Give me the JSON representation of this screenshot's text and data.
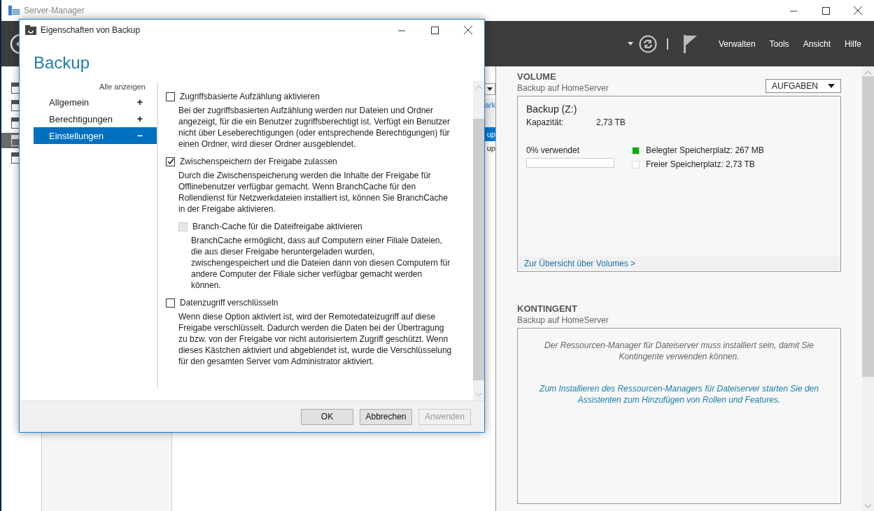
{
  "window": {
    "title": "Server-Manager"
  },
  "menu": [
    "Verwalten",
    "Tools",
    "Ansicht",
    "Hilfe"
  ],
  "nav_items": [
    {
      "selected": false
    },
    {
      "selected": false
    },
    {
      "selected": false
    },
    {
      "selected": true
    },
    {
      "selected": false
    }
  ],
  "center_pane": [
    {
      "text": "ark",
      "kind": "link",
      "selected": false
    },
    {
      "text": "up",
      "kind": "row",
      "selected": true
    },
    {
      "text": "up",
      "kind": "row",
      "selected": false
    }
  ],
  "volume": {
    "heading": "VOLUME",
    "subtitle": "Backup auf HomeServer",
    "tasks_button": "AUFGABEN",
    "name": "Backup (Z:)",
    "capacity_label": "Kapazität:",
    "capacity_value": "2,73 TB",
    "usage_text": "0% verwendet",
    "level": 0,
    "legend": [
      {
        "label": "Belegter Speicherplatz: 267 MB",
        "color": "#00b000"
      },
      {
        "label": "Freier Speicherplatz: 2,73 TB",
        "color": "#ffffff"
      }
    ],
    "footer_link": "Zur Übersicht über Volumes >"
  },
  "quota": {
    "heading": "KONTINGENT",
    "subtitle": "Backup auf HomeServer",
    "message": "Der Ressourcen-Manager für Dateiserver muss installiert sein, damit Sie Kontingente verwenden können.",
    "link": "Zum Installieren des Ressourcen-Managers für Dateiserver starten Sie den Assistenten zum Hinzufügen von Rollen und Features."
  },
  "dialog": {
    "title": "Eigenschaften von Backup",
    "heading": "Backup",
    "show_all": "Alle anzeigen",
    "sections": [
      {
        "label": "Allgemein",
        "expander": "+",
        "selected": false
      },
      {
        "label": "Berechtigungen",
        "expander": "+",
        "selected": false
      },
      {
        "label": "Einstellungen",
        "expander": "−",
        "selected": true
      }
    ],
    "options": [
      {
        "label": "Zugriffsbasierte Aufzählung aktivieren",
        "checked": false,
        "disabled": false,
        "description": "Bei der zugriffsbasierten Aufzählung werden nur Dateien und Ordner angezeigt, für die ein Benutzer zugriffsberechtigt ist. Verfügt ein Benutzer nicht über Leseberechtigungen (oder entsprechende Berechtigungen) für einen Ordner, wird dieser Ordner ausgeblendet."
      },
      {
        "label": "Zwischenspeichern der Freigabe zulassen",
        "checked": true,
        "disabled": false,
        "description": "Durch die Zwischenspeicherung werden die Inhalte der Freigabe für Offlinebenutzer verfügbar gemacht. Wenn BranchCache für den Rollendienst für Netzwerkdateien installiert ist, können Sie BranchCache in der Freigabe aktivieren.",
        "children": [
          {
            "label": "Branch-Cache für die Dateifreigabe aktivieren",
            "checked": false,
            "disabled": true,
            "description": "BranchCache ermöglicht, dass auf Computern einer Filiale Dateien, die aus dieser Freigabe heruntergeladen wurden, zwischengespeichert und die Dateien dann von diesen Computern für andere Computer der Filiale sicher verfügbar gemacht werden können."
          }
        ]
      },
      {
        "label": "Datenzugriff verschlüsseln",
        "checked": false,
        "disabled": false,
        "description": "Wenn diese Option aktiviert ist, wird der Remotedateizugriff auf diese Freigabe verschlüsselt. Dadurch werden die Daten bei der Übertragung zu bzw. von der Freigabe vor nicht autorisiertem Zugriff geschützt. Wenn dieses Kästchen aktiviert und abgeblendet ist, wurde die Verschlüsselung für den gesamten Server vom Administrator aktiviert."
      }
    ],
    "buttons": [
      {
        "label": "OK",
        "disabled": false
      },
      {
        "label": "Abbrechen",
        "disabled": false
      },
      {
        "label": "Anwenden",
        "disabled": true
      }
    ]
  }
}
